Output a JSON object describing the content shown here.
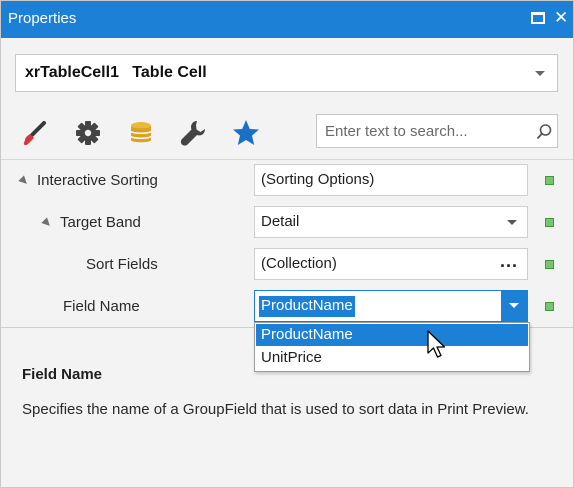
{
  "window": {
    "title": "Properties",
    "accent_color": "#1c80d7",
    "controls": [
      "maximize-icon",
      "close-icon"
    ],
    "close_glyph": "✕"
  },
  "object_selector": {
    "value": "xrTableCell1   Table Cell",
    "icon": "chevron-down-icon"
  },
  "toolbar": {
    "icons": [
      "brush-icon",
      "gear-icon",
      "database-icon",
      "wrench-icon",
      "star-icon"
    ],
    "search": {
      "placeholder": "Enter text to search...",
      "value": "",
      "icon": "search-icon"
    }
  },
  "property_grid": {
    "rows": [
      {
        "label": "Interactive Sorting",
        "value": "(Sorting Options)",
        "expanded": true,
        "marker_color": "#7cc274"
      },
      {
        "label": "Target Band",
        "value": "Detail",
        "expanded": true,
        "editor": "dropdown",
        "marker_color": "#7cc274"
      },
      {
        "label": "Sort Fields",
        "value": "(Collection)",
        "editor": "ellipsis",
        "ellipsis": "...",
        "marker_color": "#7cc274"
      },
      {
        "label": "Field Name",
        "value": "ProductName",
        "editor": "dropdown-open",
        "marker_color": "#7cc274"
      }
    ]
  },
  "dropdown_list": {
    "options": [
      "ProductName",
      "UnitPrice"
    ],
    "highlighted": "ProductName"
  },
  "description": {
    "title": "Field Name",
    "text": "Specifies the name of a GroupField that is used to sort data in Print Preview."
  }
}
